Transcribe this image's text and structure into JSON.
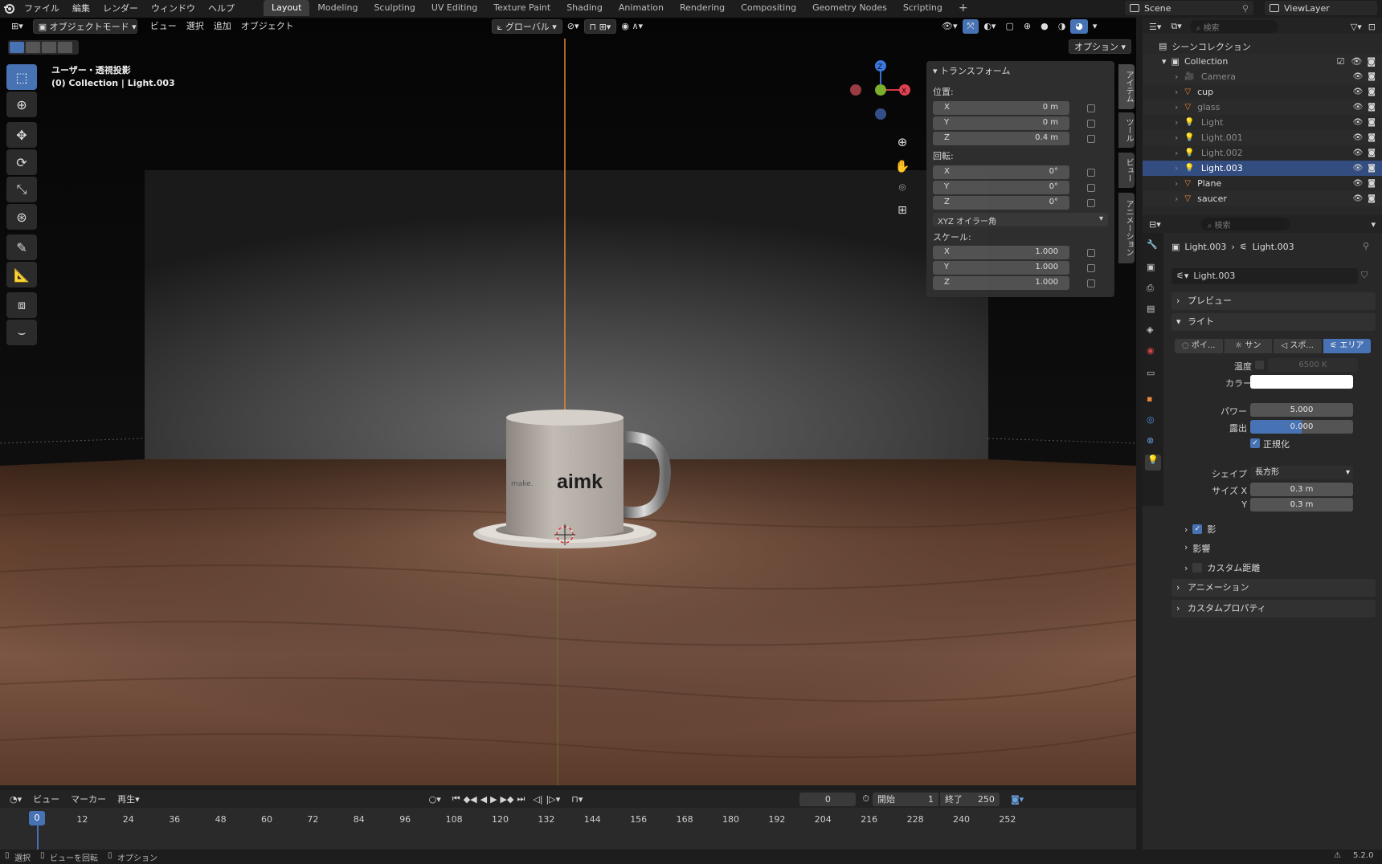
{
  "topbar": {
    "menus": [
      "ファイル",
      "編集",
      "レンダー",
      "ウィンドウ",
      "ヘルプ"
    ],
    "workspaces": [
      "Layout",
      "Modeling",
      "Sculpting",
      "UV Editing",
      "Texture Paint",
      "Shading",
      "Animation",
      "Rendering",
      "Compositing",
      "Geometry Nodes",
      "Scripting"
    ],
    "active_workspace": "Layout",
    "add_tab": "+",
    "scene": "Scene",
    "view_layer": "ViewLayer"
  },
  "viewport": {
    "mode": "オブジェクトモード",
    "menus": [
      "ビュー",
      "選択",
      "追加",
      "オブジェクト"
    ],
    "orientation": "グローバル",
    "options": "オプション",
    "info_line1": "ユーザー・透視投影",
    "info_line2": "(0) Collection | Light.003",
    "mug_text": "aimk",
    "mug_small_text": "make.",
    "gizmo_labels": {
      "x": "X",
      "y": "Y",
      "z": "Z"
    }
  },
  "npanel": {
    "title": "トランスフォーム",
    "location_label": "位置:",
    "location": [
      {
        "axis": "X",
        "value": "0 m"
      },
      {
        "axis": "Y",
        "value": "0 m"
      },
      {
        "axis": "Z",
        "value": "0.4 m"
      }
    ],
    "rotation_label": "回転:",
    "rotation": [
      {
        "axis": "X",
        "value": "0°"
      },
      {
        "axis": "Y",
        "value": "0°"
      },
      {
        "axis": "Z",
        "value": "0°"
      }
    ],
    "rotation_mode": "XYZ オイラー角",
    "scale_label": "スケール:",
    "scale": [
      {
        "axis": "X",
        "value": "1.000"
      },
      {
        "axis": "Y",
        "value": "1.000"
      },
      {
        "axis": "Z",
        "value": "1.000"
      }
    ],
    "side_tabs": [
      "アイテム",
      "ツール",
      "ビュー",
      "アニメーション"
    ]
  },
  "outliner": {
    "search_placeholder": "検索",
    "scene_collection": "シーンコレクション",
    "collection": "Collection",
    "items": [
      {
        "name": "Camera",
        "type": "camera"
      },
      {
        "name": "cup",
        "type": "mesh"
      },
      {
        "name": "glass",
        "type": "mesh"
      },
      {
        "name": "Light",
        "type": "light"
      },
      {
        "name": "Light.001",
        "type": "light"
      },
      {
        "name": "Light.002",
        "type": "light"
      },
      {
        "name": "Light.003",
        "type": "light",
        "selected": true
      },
      {
        "name": "Plane",
        "type": "mesh"
      },
      {
        "name": "saucer",
        "type": "mesh"
      }
    ]
  },
  "properties": {
    "search_placeholder": "検索",
    "breadcrumb_object": "Light.003",
    "breadcrumb_data": "Light.003",
    "datablock": "Light.003",
    "panels": {
      "preview": "プレビュー",
      "light": "ライト",
      "animation": "アニメーション",
      "custom_props": "カスタムプロパティ"
    },
    "light_types": [
      "ポイ...",
      "サン",
      "スポ...",
      "エリア"
    ],
    "active_light_type": "エリア",
    "temperature_label": "温度",
    "temperature_value": "6500 K",
    "color_label": "カラー",
    "power_label": "パワー",
    "power_value": "5.000",
    "exposure_label": "露出",
    "exposure_value": "0.000",
    "normalize_label": "正規化",
    "shape_label": "シェイプ",
    "shape_value": "長方形",
    "size_x_label": "サイズ X",
    "size_x_value": "0.3 m",
    "size_y_label": "Y",
    "size_y_value": "0.3 m",
    "sub_panels": [
      "影",
      "影響",
      "カスタム距離"
    ]
  },
  "timeline": {
    "menus": [
      "ビュー",
      "マーカー",
      "再生"
    ],
    "current_frame": "0",
    "start_label": "開始",
    "start_value": "1",
    "end_label": "終了",
    "end_value": "250",
    "ticks": [
      "0",
      "12",
      "24",
      "36",
      "48",
      "60",
      "72",
      "84",
      "96",
      "108",
      "120",
      "132",
      "144",
      "156",
      "168",
      "180",
      "192",
      "204",
      "216",
      "228",
      "240",
      "252"
    ]
  },
  "statusbar": {
    "select": "選択",
    "rotate_view": "ビューを回転",
    "options": "オプション",
    "version": "5.2.0"
  },
  "colors": {
    "accent": "#4772b3",
    "selected_row": "#334d80",
    "orange_line": "#e08a2c",
    "panel_bg": "#303030"
  }
}
